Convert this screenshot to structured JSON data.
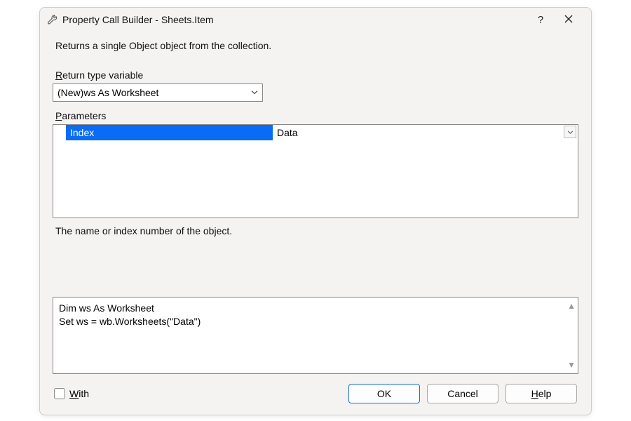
{
  "title": "Property Call Builder - Sheets.Item",
  "description": "Returns a single Object object from the collection.",
  "return_label": "Return type variable",
  "return_value": "(New)ws As Worksheet",
  "params_label": "Parameters",
  "params": [
    {
      "name": "Index",
      "value": "Data"
    }
  ],
  "hint": "The name or index number of the object.",
  "code": "Dim ws As Worksheet\nSet ws = wb.Worksheets(\"Data\")",
  "with_label": "With",
  "buttons": {
    "ok": "OK",
    "cancel": "Cancel",
    "help_prefix": "H",
    "help_rest": "elp"
  }
}
